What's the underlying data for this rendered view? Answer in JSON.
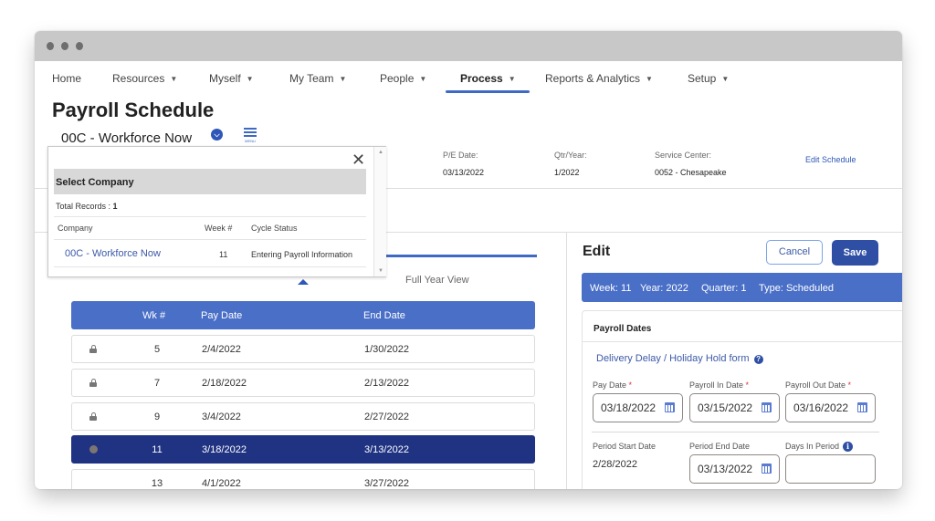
{
  "window": {
    "controls": [
      "close",
      "minimize",
      "maximize"
    ]
  },
  "nav": {
    "items": [
      {
        "label": "Home",
        "has_caret": false,
        "active": false
      },
      {
        "label": "Resources",
        "has_caret": true,
        "active": false
      },
      {
        "label": "Myself",
        "has_caret": true,
        "active": false
      },
      {
        "label": "My Team",
        "has_caret": true,
        "active": false
      },
      {
        "label": "People",
        "has_caret": true,
        "active": false
      },
      {
        "label": "Process",
        "has_caret": true,
        "active": true
      },
      {
        "label": "Reports & Analytics",
        "has_caret": true,
        "active": false
      },
      {
        "label": "Setup",
        "has_caret": true,
        "active": false
      }
    ],
    "caret_glyph": "▼"
  },
  "page": {
    "title": "Payroll Schedule",
    "company": "00C - Workforce Now",
    "menu_label": "MENU"
  },
  "info": {
    "pe_date": {
      "label": "P/E Date:",
      "value": "03/13/2022"
    },
    "qtr_year": {
      "label": "Qtr/Year:",
      "value": "1/2022"
    },
    "service_center": {
      "label": "Service Center:",
      "value": "0052 - Chesapeake"
    },
    "edit_schedule": "Edit Schedule"
  },
  "view_toggle": {
    "full_year": "Full Year View"
  },
  "schedule_table": {
    "columns": [
      "Wk #",
      "Pay Date",
      "End Date"
    ],
    "rows": [
      {
        "week": "5",
        "pay_date": "2/4/2022",
        "end_date": "1/30/2022",
        "status": "locked"
      },
      {
        "week": "7",
        "pay_date": "2/18/2022",
        "end_date": "2/13/2022",
        "status": "locked"
      },
      {
        "week": "9",
        "pay_date": "3/4/2022",
        "end_date": "2/27/2022",
        "status": "locked"
      },
      {
        "week": "11",
        "pay_date": "3/18/2022",
        "end_date": "3/13/2022",
        "status": "current"
      },
      {
        "week": "13",
        "pay_date": "4/1/2022",
        "end_date": "3/27/2022",
        "status": "open"
      }
    ]
  },
  "edit_panel": {
    "title": "Edit",
    "cancel": "Cancel",
    "save": "Save",
    "summary": {
      "week": "Week: 11",
      "year": "Year: 2022",
      "quarter": "Quarter: 1",
      "type": "Type: Scheduled"
    },
    "payroll_dates": {
      "title": "Payroll Dates",
      "hold_link": "Delivery Delay / Holiday Hold form",
      "help_glyph": "?",
      "required_mark": "*",
      "pay_date": {
        "label": "Pay Date",
        "value": "03/18/2022"
      },
      "payroll_in": {
        "label": "Payroll In Date",
        "value": "03/15/2022"
      },
      "payroll_out": {
        "label": "Payroll Out Date",
        "value": "03/16/2022"
      },
      "period_start": {
        "label": "Period Start Date",
        "value": "2/28/2022"
      },
      "period_end": {
        "label": "Period End Date",
        "value": "03/13/2022"
      },
      "days_in_period": {
        "label": "Days In Period",
        "value": ""
      },
      "info_glyph": "i"
    }
  },
  "company_dropdown": {
    "close_glyph": "✕",
    "title": "Select Company",
    "total_label": "Total Records : ",
    "total_value": "1",
    "columns": [
      "Company",
      "Week #",
      "Cycle Status"
    ],
    "rows": [
      {
        "company": "00C - Workforce Now",
        "week": "11",
        "status": "Entering Payroll Information"
      }
    ]
  },
  "colors": {
    "accent": "#3f6ac4",
    "header_blue": "#4a6fc7",
    "selected_row": "#203282",
    "save_button": "#2f4fa5",
    "link": "#3c5aa8"
  }
}
